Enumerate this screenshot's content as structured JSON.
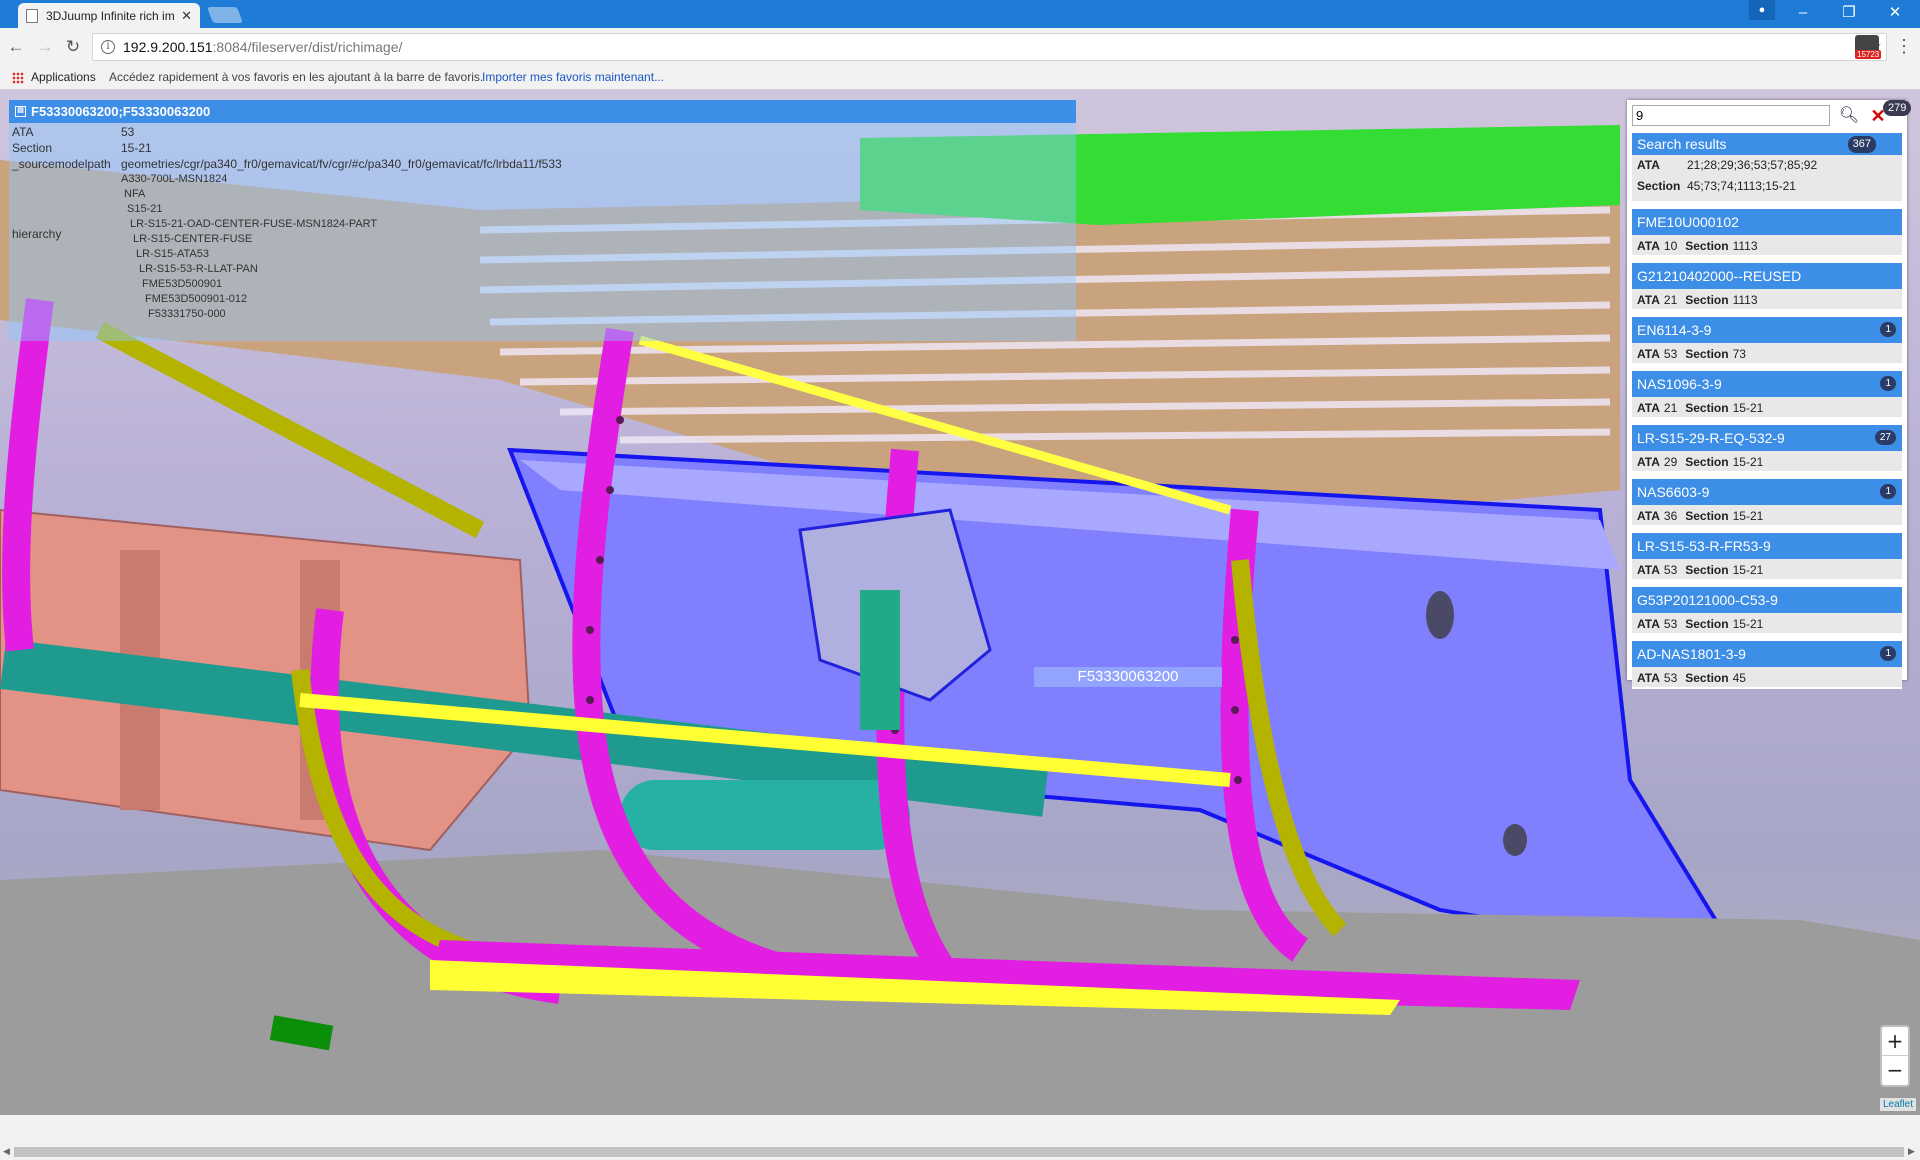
{
  "browser": {
    "tab_title": "3DJuump Infinite rich im",
    "url_host": "192.9.200.151",
    "url_rest": ":8084/fileserver/dist/richimage/",
    "bookmarks": {
      "apps_label": "Applications",
      "hint": "Accédez rapidement à vos favoris en les ajoutant à la barre de favoris.",
      "import_link": "Importer mes favoris maintenant..."
    },
    "extension_badge": "15723"
  },
  "info_panel": {
    "title": "F53330063200;F53330063200",
    "rows": [
      {
        "key": "ATA",
        "value": "53"
      },
      {
        "key": "Section",
        "value": "15-21"
      },
      {
        "key": "_sourcemodelpath",
        "value": "geometries/cgr/pa340_fr0/gemavicat/fv/cgr/#c/pa340_fr0/gemavicat/fc/lrbda11/f533"
      }
    ],
    "hierarchy_key": "hierarchy",
    "hierarchy": [
      "A330-700L-MSN1824",
      "NFA",
      "S15-21",
      "LR-S15-21-OAD-CENTER-FUSE-MSN1824-PART",
      "LR-S15-CENTER-FUSE",
      "LR-S15-ATA53",
      "LR-S15-53-R-LLAT-PAN",
      "FME53D500901",
      "FME53D500901-012",
      "F53331750-000"
    ]
  },
  "viewer": {
    "part_label": "F53330063200",
    "zoom_in": "+",
    "zoom_out": "−",
    "attribution": "Leaflet"
  },
  "search": {
    "query": "9",
    "total_count": "279",
    "summary": {
      "title": "Search results",
      "count": "367",
      "ata_label": "ATA",
      "ata_values": "21;28;29;36;53;57;85;92",
      "section_label": "Section",
      "section_values": "45;73;74;1113;15-21"
    },
    "ata_label": "ATA",
    "section_label": "Section",
    "results": [
      {
        "name": "FME10U000102",
        "ata": "10",
        "section": "1113",
        "count": ""
      },
      {
        "name": "G21210402000--REUSED",
        "ata": "21",
        "section": "1113",
        "count": ""
      },
      {
        "name": "EN6114-3-9",
        "ata": "53",
        "section": "73",
        "count": "1"
      },
      {
        "name": "NAS1096-3-9",
        "ata": "21",
        "section": "15-21",
        "count": "1"
      },
      {
        "name": "LR-S15-29-R-EQ-532-9",
        "ata": "29",
        "section": "15-21",
        "count": "27"
      },
      {
        "name": "NAS6603-9",
        "ata": "36",
        "section": "15-21",
        "count": "1"
      },
      {
        "name": "LR-S15-53-R-FR53-9",
        "ata": "53",
        "section": "15-21",
        "count": ""
      },
      {
        "name": "G53P20121000-C53-9",
        "ata": "53",
        "section": "15-21",
        "count": ""
      },
      {
        "name": "AD-NAS1801-3-9",
        "ata": "53",
        "section": "45",
        "count": "1"
      }
    ]
  }
}
